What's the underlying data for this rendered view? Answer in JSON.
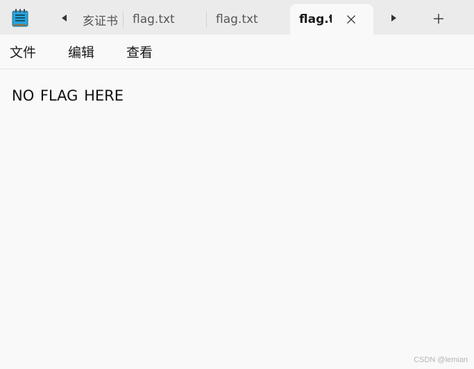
{
  "app": {
    "icon": "notepad-icon"
  },
  "tabs": [
    {
      "label": "亥证书",
      "active": false
    },
    {
      "label": "flag.txt",
      "active": false
    },
    {
      "label": "flag.txt",
      "active": false
    },
    {
      "label": "flag.txt",
      "active": true
    }
  ],
  "tab_controls": {
    "scroll_left_icon": "triangle-left-icon",
    "scroll_right_icon": "triangle-right-icon",
    "close_icon": "close-icon",
    "new_tab_icon": "plus-icon"
  },
  "menu": {
    "file": "文件",
    "edit": "编辑",
    "view": "查看"
  },
  "editor": {
    "content": "NO FLAG HERE"
  },
  "watermark": "CSDN @lemian",
  "colors": {
    "titlebar": "#ebebeb",
    "content_background": "#f9f9f9",
    "icon_blue": "#29a3d8"
  }
}
